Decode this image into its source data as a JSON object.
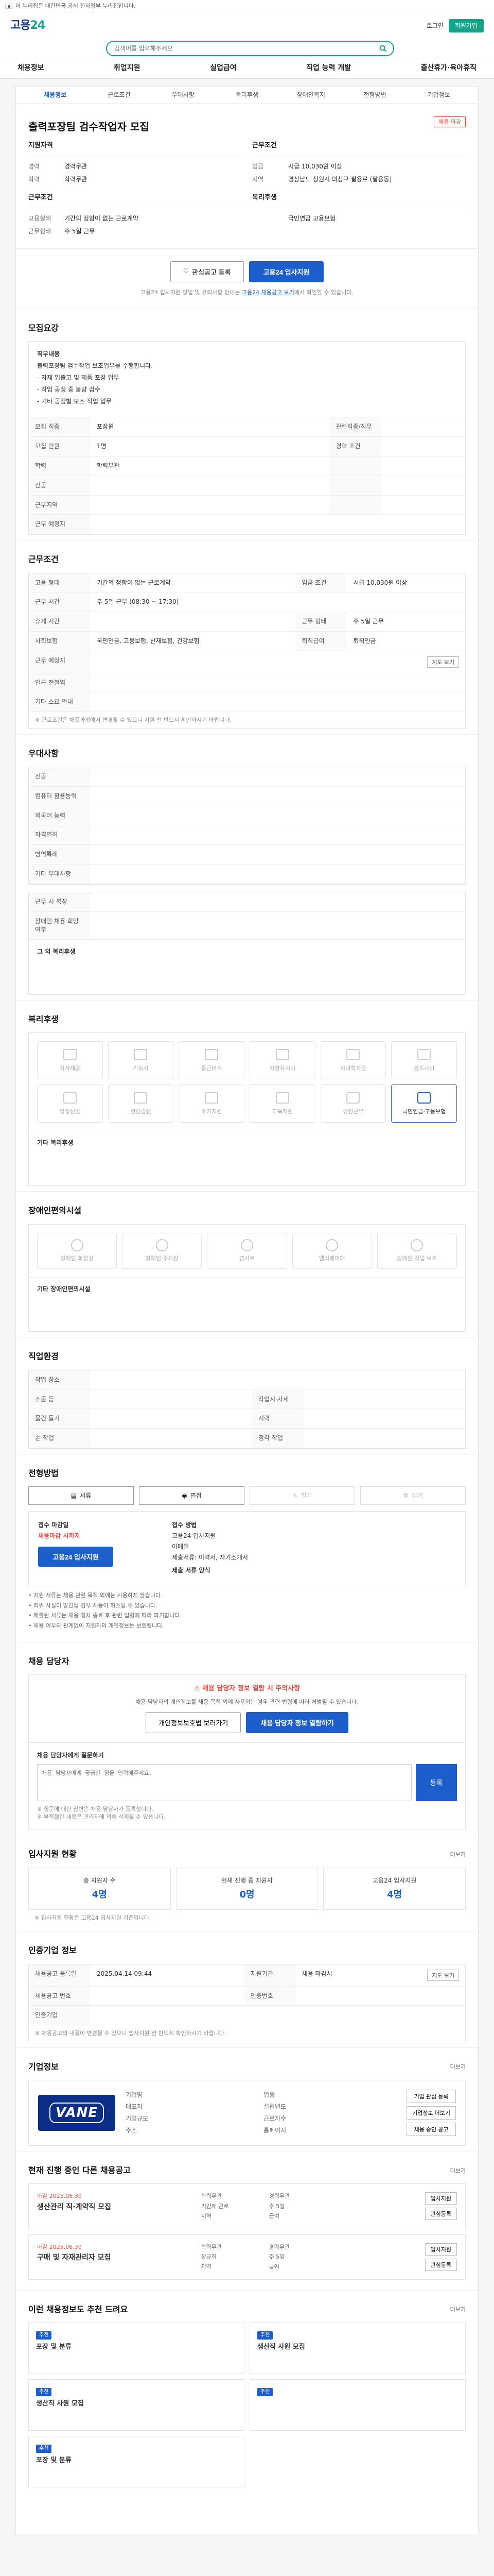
{
  "gov_banner": {
    "text": "이 누리집은 대한민국 공식 전자정부 누리집입니다."
  },
  "header": {
    "logo_main": "고용",
    "logo_accent": "24",
    "links": [
      "로그인",
      "회원가입"
    ],
    "search_placeholder": "검색어를 입력해주세요",
    "gnb": [
      "채용정보",
      "취업지원",
      "실업급여",
      "직업 능력 개발",
      "출산휴가·육아휴직"
    ]
  },
  "sub_tabs": [
    "채용정보",
    "근로조건",
    "우대사항",
    "복리후생",
    "장애인복지",
    "전형방법",
    "기업정보"
  ],
  "job": {
    "company": "",
    "title": "출력포장팀 검수작업자 모집",
    "badge": "채용 마감",
    "summary_left_title": "지원자격",
    "summary_left": [
      {
        "k": "경력",
        "v": "경력무관"
      },
      {
        "k": "학력",
        "v": "학력무관"
      }
    ],
    "summary_right_title": "근무조건",
    "summary_right": [
      {
        "k": "임금",
        "v": "시급 10,030원 이상"
      },
      {
        "k": "지역",
        "v": "경상남도 창원시 의창구 팔용로 (팔용동)"
      }
    ],
    "summary_left2_title": "근무조건",
    "summary_left2": [
      {
        "k": "고용형태",
        "v": "기간의 정함이 없는 근로계약"
      },
      {
        "k": "근무형태",
        "v": "주 5일 근무"
      }
    ],
    "summary_right2_title": "복리후생",
    "summary_right2": [
      {
        "k": "",
        "v": "국민연금 고용보험"
      }
    ]
  },
  "apply": {
    "save_label": "관심공고 등록",
    "apply_label": "고용24 입사지원",
    "note_prefix": "고용24 입사지원 방법 및 유의사항 안내는",
    "note_link": "고용24 채용공고 보기",
    "note_suffix": "에서 확인할 수 있습니다."
  },
  "sections": {
    "recruit_title": "모집요강",
    "work_title": "근무조건",
    "pref_title": "우대사항",
    "welfare_title": "복리후생",
    "disability_title": "장애인편의시설",
    "worker_title": "직업환경",
    "method_title": "전형방법",
    "contact_title": "채용 담당자",
    "status_title": "입사지원 현황",
    "history_title": "인증기업 정보",
    "company_title": "기업정보",
    "other_jobs_title": "현재 진행 중인 다른 채용공고",
    "rec_title": "이런 채용정보도 추천 드려요"
  },
  "recruit": {
    "desc_title": "직무내용",
    "desc_lines": [
      "출력포장팀 검수작업 보조업무를 수행합니다.",
      "- 자재 입출고 및 제품 포장 업무",
      "- 작업 공정 중 불량 검수",
      "- 기타 공정별 보조 작업 업무"
    ],
    "rows": [
      {
        "k": "모집 직종",
        "v": "포장원",
        "k2": "관련직종/직무",
        "v2": ""
      },
      {
        "k": "모집 인원",
        "v": "1명",
        "k2": "경력 조건",
        "v2": ""
      },
      {
        "k": "학력",
        "v": "학력무관",
        "k2": "",
        "v2": ""
      },
      {
        "k": "전공",
        "v": "",
        "k2": "",
        "v2": ""
      },
      {
        "k": "근무지역",
        "v": "",
        "k2": "",
        "v2": ""
      },
      {
        "k": "근무 예정지",
        "v": "",
        "k2": "",
        "v2": ""
      }
    ]
  },
  "work": {
    "rows": [
      {
        "k": "고용 형태",
        "v": "기간의 정함이 없는 근로계약",
        "k2": "임금 조건",
        "v2": "시급 10,030원 이상"
      },
      {
        "k": "근무 시간",
        "v": "주 5일 근무 (08:30 ~ 17:30)",
        "k2": "",
        "v2": ""
      },
      {
        "k": "휴게 시간",
        "v": "",
        "k2": "근무 형태",
        "v2": "주 5일 근무"
      },
      {
        "k": "사회보험",
        "v": "국민연금, 고용보험, 산재보험, 건강보험",
        "k2": "퇴직급여",
        "v2": "퇴직연금"
      },
      {
        "k": "근무 예정지",
        "v": "",
        "k2": "",
        "v2": ""
      },
      {
        "k": "인근 전철역",
        "v": "",
        "k2": "",
        "v2": ""
      },
      {
        "k": "기타 소요 안내",
        "v": "",
        "k2": "",
        "v2": ""
      }
    ],
    "map_btn": "지도 보기",
    "note": "※ 근로조건은 채용과정에서 변경될 수 있으니 지원 전 반드시 확인하시기 바랍니다."
  },
  "pref": {
    "rows": [
      {
        "k": "전공",
        "v": ""
      },
      {
        "k": "컴퓨터 활용능력",
        "v": ""
      },
      {
        "k": "외국어 능력",
        "v": ""
      },
      {
        "k": "자격면허",
        "v": ""
      },
      {
        "k": "병역특례",
        "v": ""
      },
      {
        "k": "기타 우대사항",
        "v": ""
      }
    ]
  },
  "etc": {
    "rows": [
      {
        "k": "근무 시 복장",
        "v": ""
      },
      {
        "k": "장애인 채용 희망 여부",
        "v": ""
      }
    ],
    "sub_title": "그 외 복리후생",
    "sub_value": ""
  },
  "welfare": {
    "items": [
      {
        "label": "식사제공",
        "on": false
      },
      {
        "label": "기숙사",
        "on": false
      },
      {
        "label": "통근버스",
        "on": false
      },
      {
        "label": "차량유지비",
        "on": false
      },
      {
        "label": "자녀학자금",
        "on": false
      },
      {
        "label": "경조사비",
        "on": false
      },
      {
        "label": "명절선물",
        "on": false
      },
      {
        "label": "건강검진",
        "on": false
      },
      {
        "label": "주거지원",
        "on": false
      },
      {
        "label": "교육지원",
        "on": false
      },
      {
        "label": "유연근무",
        "on": false
      },
      {
        "label": "국민연금·고용보험",
        "on": true
      }
    ],
    "sub_title": "기타 복리후생",
    "sub_value": ""
  },
  "disability": {
    "items": [
      {
        "label": "장애인 화장실"
      },
      {
        "label": "장애인 주차장"
      },
      {
        "label": "경사로"
      },
      {
        "label": "엘리베이터"
      },
      {
        "label": "장애인 작업 보조"
      }
    ],
    "sub_title": "기타 장애인편의시설",
    "sub_value": ""
  },
  "environment": {
    "rows": [
      {
        "k": "작업 장소",
        "v": "",
        "k2": "",
        "v2": ""
      },
      {
        "k": "소음 등",
        "v": "",
        "k2": "작업시 자세",
        "v2": ""
      },
      {
        "k": "물건 들기",
        "v": "",
        "k2": "시력",
        "v2": ""
      },
      {
        "k": "손 작업",
        "v": "",
        "k2": "청각 작업",
        "v2": ""
      }
    ]
  },
  "method": {
    "tabs": [
      {
        "label": "서류",
        "on": true
      },
      {
        "label": "면접",
        "on": true
      },
      {
        "label": "필기",
        "on": false
      },
      {
        "label": "실기",
        "on": false
      }
    ],
    "left_label": "접수 마감일",
    "left_value": "채용마감 시까지",
    "left_btn": "고용24 입사지원",
    "right_title": "접수 방법",
    "right_lines": [
      "고용24 입사지원",
      "이메일",
      "제출서류: 이력서, 자기소개서"
    ],
    "right_sub": "제출 서류 양식",
    "bullets": [
      "지원 서류는 채용 관련 목적 외에는 사용하지 않습니다.",
      "허위 사실이 발견될 경우 채용이 취소될 수 있습니다.",
      "제출된 서류는 채용 절차 종료 후 관련 법령에 따라 파기합니다.",
      "채용 여부와 관계없이 지원자의 개인정보는 보호됩니다."
    ]
  },
  "contact": {
    "warn_title": "채용 담당자 정보 열람 시 주의사항",
    "warn_desc": "채용 담당자의 개인정보를 채용 목적 외에 사용하는 경우 관련 법령에 따라 처벌될 수 있습니다.",
    "btn_left": "개인정보보호법 보러가기",
    "btn_right": "채용 담당자 정보 열람하기",
    "qa_title": "채용 담당자에게 질문하기",
    "qa_placeholder": "채용 담당자에게 궁금한 점을 입력해주세요.",
    "qa_submit": "등록",
    "qa_notes": [
      "※ 질문에 대한 답변은 채용 담당자가 등록합니다.",
      "※ 부적절한 내용은 관리자에 의해 삭제될 수 있습니다."
    ]
  },
  "status": {
    "cards": [
      {
        "label": "총 지원자 수",
        "num": "4명"
      },
      {
        "label": "현재 진행 중 지원자",
        "num": "0명"
      },
      {
        "label": "고용24 입사지원",
        "num": "4명"
      }
    ],
    "more": "더보기",
    "note": "※ 입사지원 현황은 고용24 입사지원 기준입니다."
  },
  "history": {
    "rows": [
      {
        "k": "채용공고 등록일",
        "v": "2025.04.14 09:44",
        "k2": "지원기간",
        "v2": "채용 마감시",
        "btn": "지도 보기"
      },
      {
        "k": "채용공고 번호",
        "v": "",
        "k2": "인증번호",
        "v2": ""
      },
      {
        "k": "인증기업",
        "v": "",
        "k2": "",
        "v2": ""
      }
    ],
    "note": "※ 채용공고의 내용이 변경될 수 있으니 입사지원 전 반드시 확인하시기 바랍니다."
  },
  "company": {
    "logo_text": "VANE",
    "info": [
      {
        "k": "기업명",
        "v": ""
      },
      {
        "k": "업종",
        "v": ""
      },
      {
        "k": "대표자",
        "v": ""
      },
      {
        "k": "설립년도",
        "v": ""
      },
      {
        "k": "기업규모",
        "v": ""
      },
      {
        "k": "근로자수",
        "v": ""
      },
      {
        "k": "주소",
        "v": ""
      },
      {
        "k": "홈페이지",
        "v": ""
      }
    ],
    "btns": [
      "기업 관심 등록",
      "기업정보 더보기",
      "채용 중인 공고"
    ],
    "more": "더보기"
  },
  "other_jobs": {
    "more": "더보기",
    "items": [
      {
        "date": "마감 2025.06.30",
        "title": "생산관리 직·계약직 모집",
        "meta": [
          "학력무관",
          "경력무관",
          "기간제 근로",
          "주 5일",
          "지역",
          "급여"
        ],
        "btns": [
          "입사지원",
          "관심등록"
        ]
      },
      {
        "date": "마감 2025.06.30",
        "title": "구매 및 자재관리자 모집",
        "meta": [
          "학력무관",
          "경력무관",
          "정규직",
          "주 5일",
          "지역",
          "급여"
        ],
        "btns": [
          "입사지원",
          "관심등록"
        ]
      }
    ]
  },
  "recommend": {
    "more": "더보기",
    "items": [
      {
        "tag": "추천",
        "company": "",
        "title": "포장 및 분류",
        "meta": ""
      },
      {
        "tag": "추천",
        "company": "",
        "title": "생산직 사원 모집",
        "meta": ""
      },
      {
        "tag": "추천",
        "company": "",
        "title": "생산직 사원 모집",
        "meta": ""
      },
      {
        "tag": "추천",
        "company": "",
        "title": "",
        "meta": ""
      },
      {
        "tag": "추천",
        "company": "",
        "title": "포장 및 분류",
        "meta": ""
      }
    ]
  }
}
